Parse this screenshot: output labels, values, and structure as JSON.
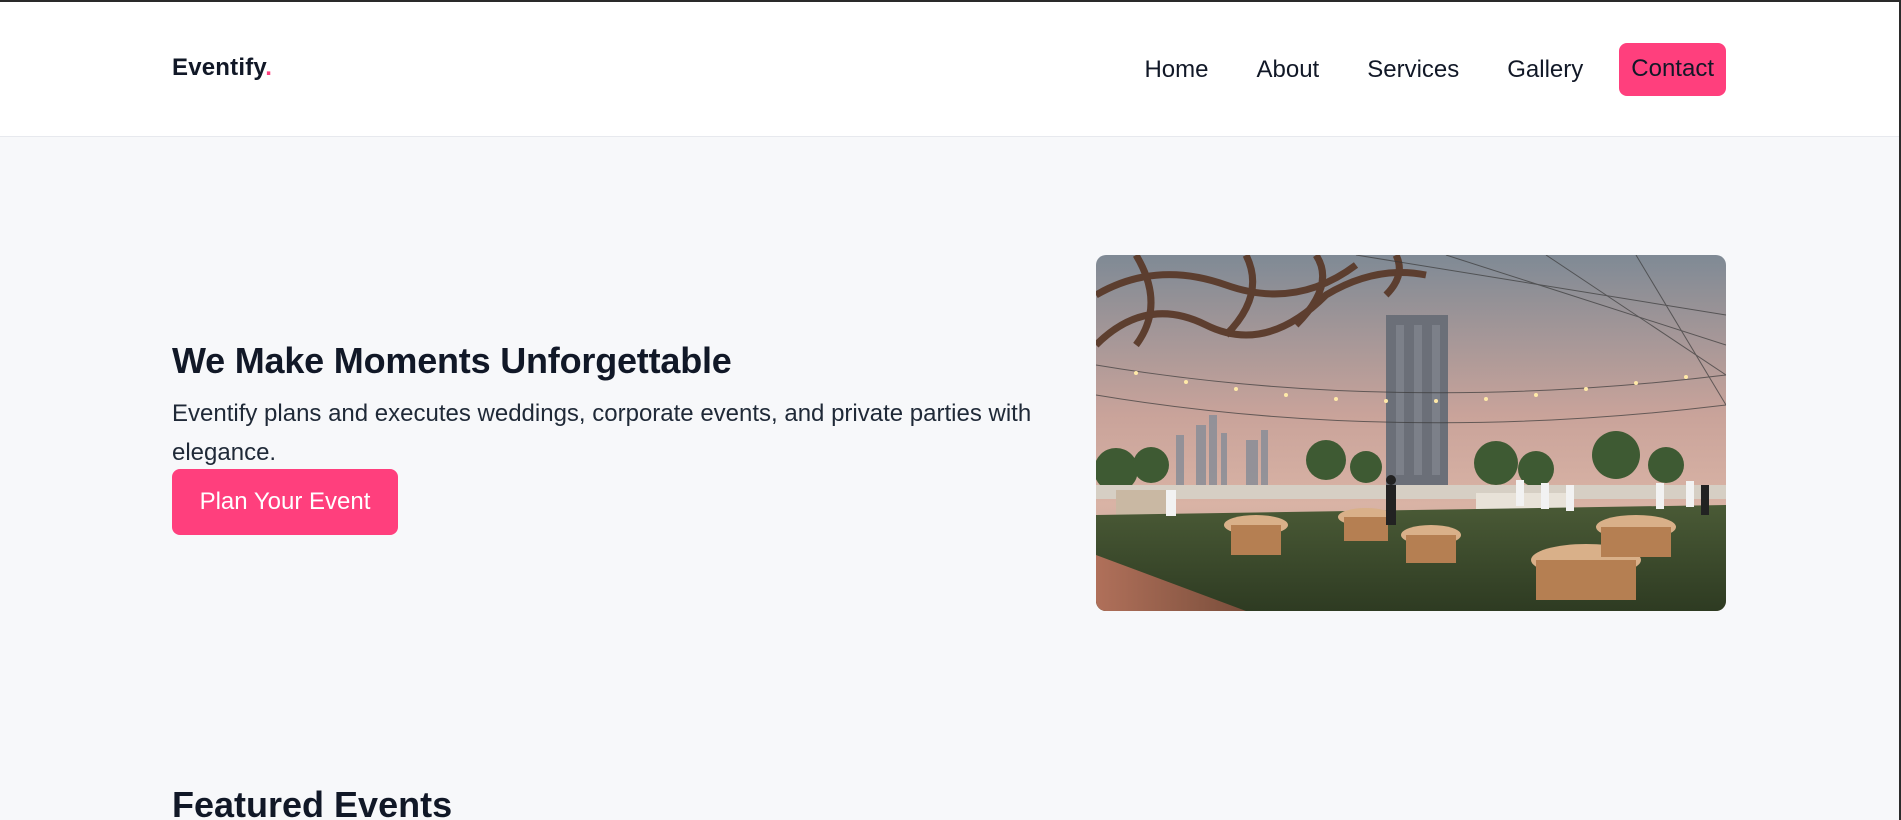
{
  "brand": {
    "name": "Eventify",
    "dot": "."
  },
  "nav": {
    "items": [
      {
        "label": "Home"
      },
      {
        "label": "About"
      },
      {
        "label": "Services"
      },
      {
        "label": "Gallery"
      },
      {
        "label": "Contact"
      }
    ]
  },
  "hero": {
    "title": "We Make Moments Unforgettable",
    "description": "Eventify plans and executes weddings, corporate events, and private parties with elegance.",
    "cta_label": "Plan Your Event",
    "image_alt": "rooftop event venue with round tables and string lights at dusk"
  },
  "featured": {
    "title": "Featured Events"
  },
  "colors": {
    "accent": "#ff3f7d",
    "text": "#111827",
    "background": "#f7f8fa",
    "navbar": "#ffffff"
  },
  "icons": [
    "event-photo"
  ]
}
